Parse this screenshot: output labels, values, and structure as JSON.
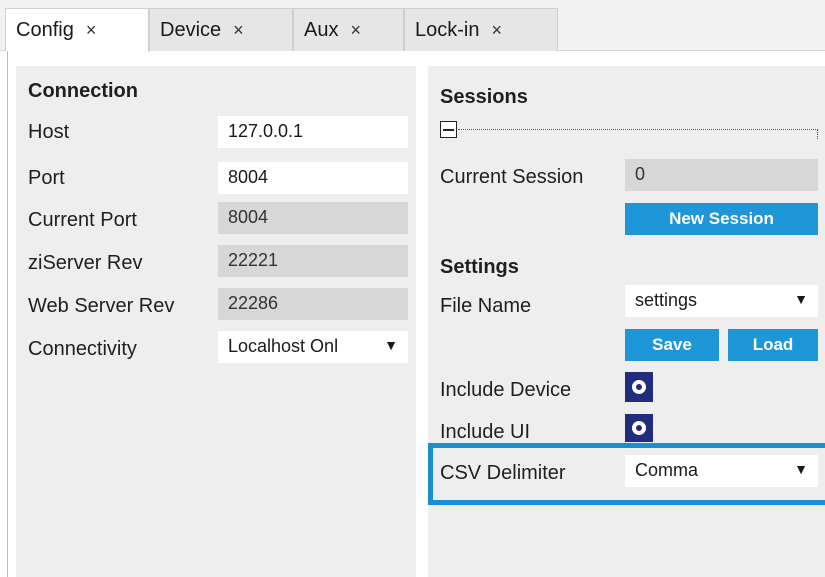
{
  "tabs": [
    {
      "label": "Config",
      "close": "×"
    },
    {
      "label": "Device",
      "close": "×"
    },
    {
      "label": "Aux",
      "close": "×"
    },
    {
      "label": "Lock-in",
      "close": "×"
    }
  ],
  "connection": {
    "title": "Connection",
    "host_label": "Host",
    "host_value": "127.0.0.1",
    "port_label": "Port",
    "port_value": "8004",
    "current_port_label": "Current Port",
    "current_port_value": "8004",
    "ziserver_rev_label": "ziServer Rev",
    "ziserver_rev_value": "22221",
    "web_server_rev_label": "Web Server Rev",
    "web_server_rev_value": "22286",
    "connectivity_label": "Connectivity",
    "connectivity_value": "Localhost Onl",
    "dropdown_arrow": "▼"
  },
  "sessions": {
    "title": "Sessions",
    "current_session_label": "Current Session",
    "current_session_value": "0",
    "new_session_button": "New Session"
  },
  "settings": {
    "title": "Settings",
    "file_name_label": "File Name",
    "file_name_value": "settings",
    "save_button": "Save",
    "load_button": "Load",
    "include_device_label": "Include Device",
    "include_ui_label": "Include UI",
    "csv_delimiter_label": "CSV Delimiter",
    "csv_delimiter_value": "Comma",
    "dropdown_arrow": "▼"
  },
  "colors": {
    "accent": "#1e96d8",
    "radio": "#1f2d7a",
    "highlight": "#1b8fd0"
  }
}
